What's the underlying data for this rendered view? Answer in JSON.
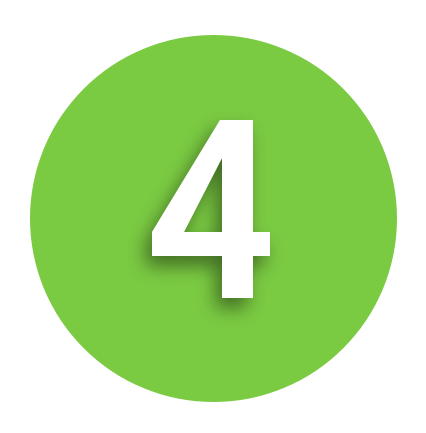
{
  "badge": {
    "number": "4",
    "background_color": "#7aca42",
    "numeral_color": "#ffffff"
  }
}
